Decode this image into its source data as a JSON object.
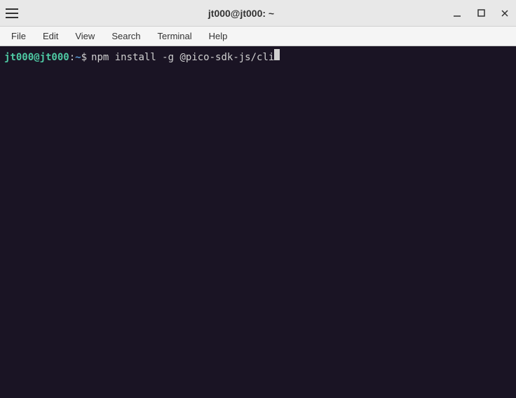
{
  "window": {
    "title": "jt000@jt000: ~"
  },
  "menubar": {
    "items": [
      "File",
      "Edit",
      "View",
      "Search",
      "Terminal",
      "Help"
    ]
  },
  "terminal": {
    "prompt_user": "jt000@jt000",
    "prompt_colon": ":",
    "prompt_path": "~",
    "prompt_dollar": "$",
    "command": "npm install -g @pico-sdk-js/cli"
  }
}
